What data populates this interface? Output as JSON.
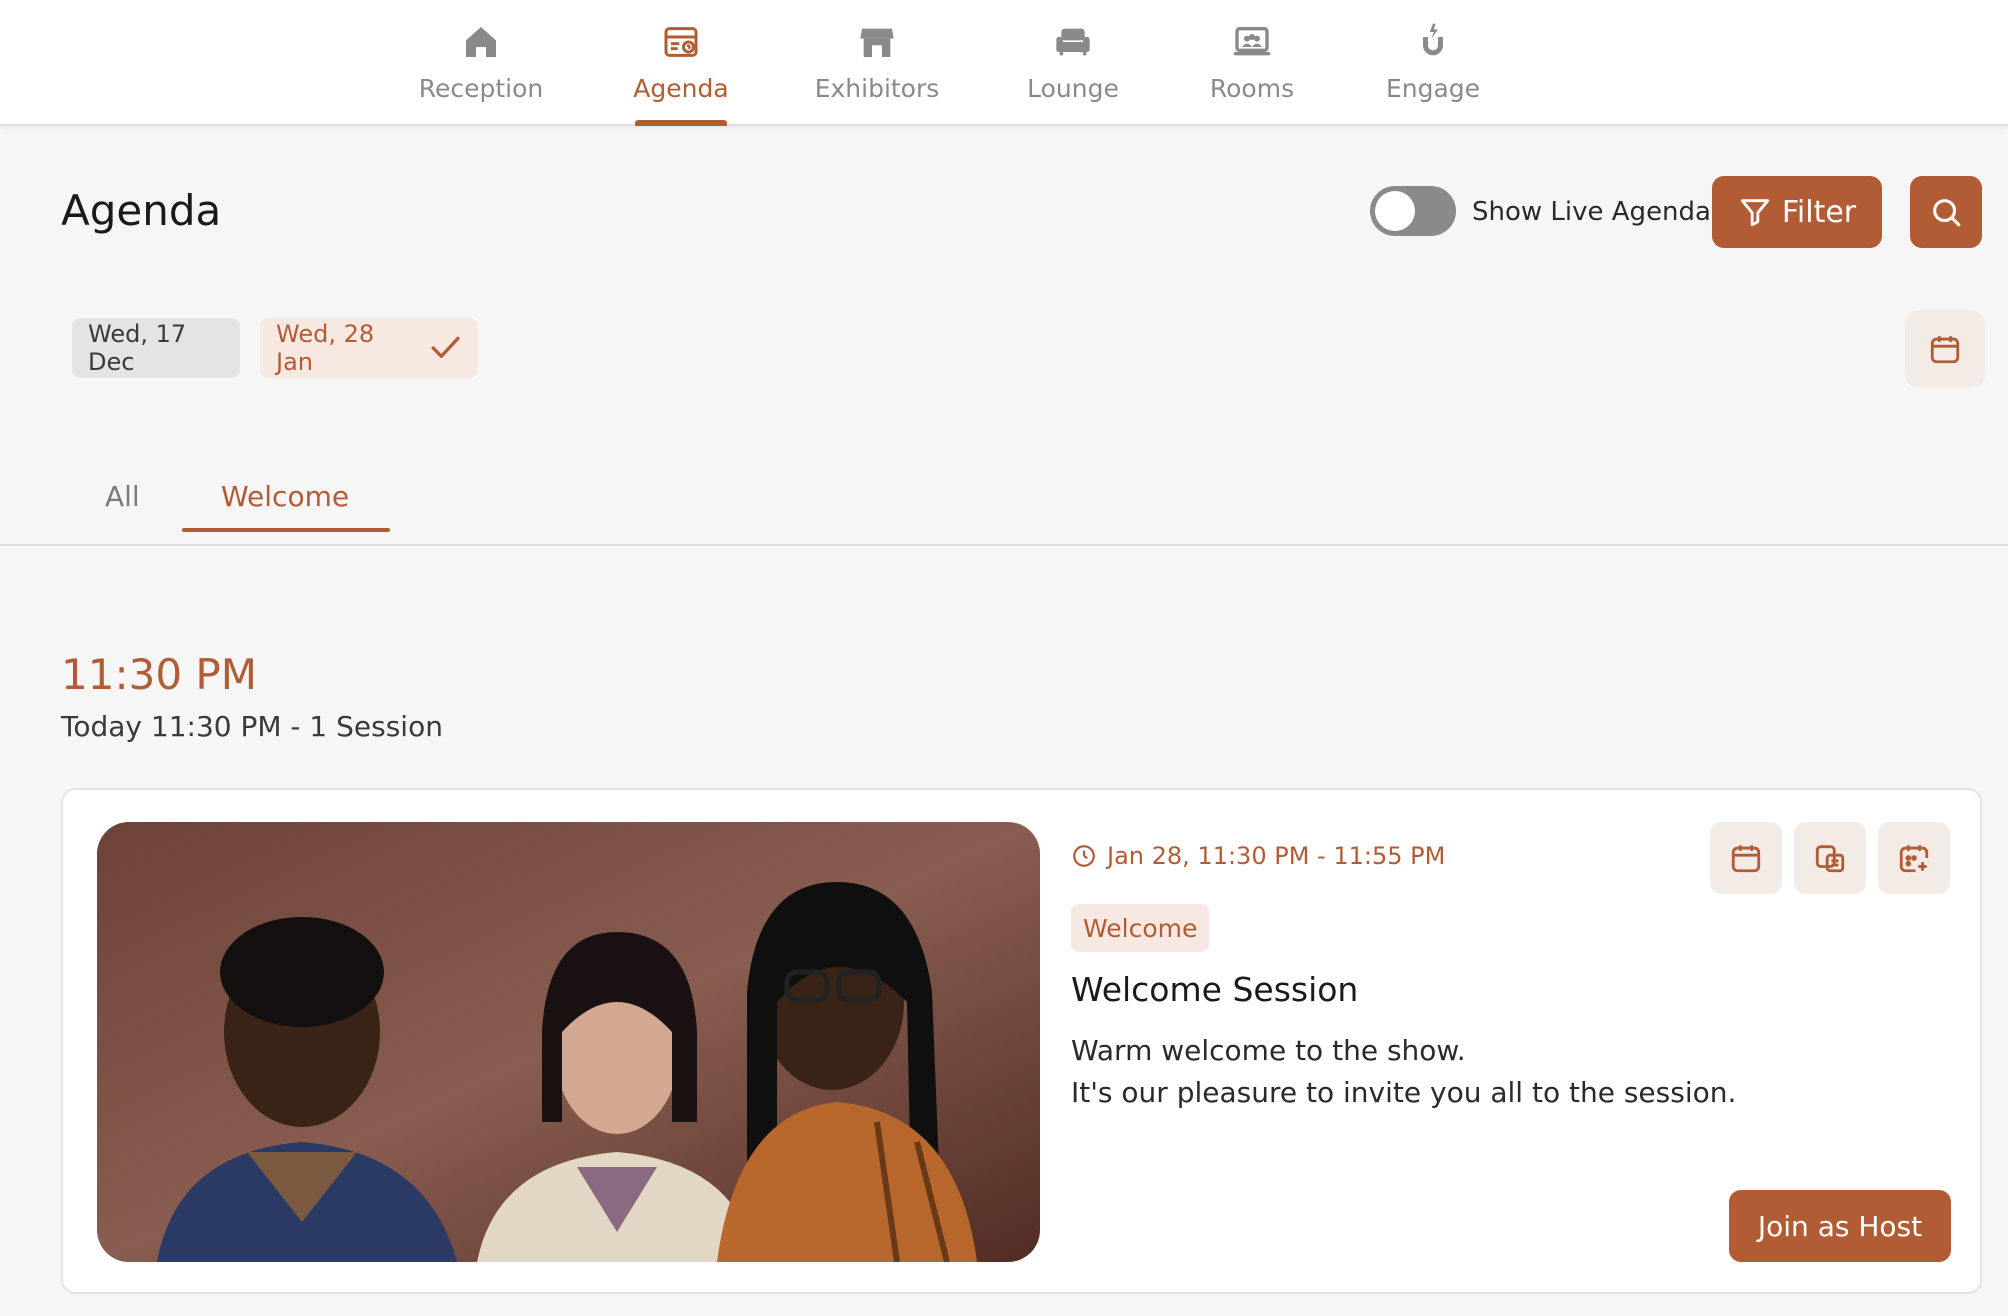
{
  "nav": {
    "items": [
      {
        "label": "Reception",
        "icon": "home-icon"
      },
      {
        "label": "Agenda",
        "icon": "agenda-icon",
        "active": true
      },
      {
        "label": "Exhibitors",
        "icon": "store-icon"
      },
      {
        "label": "Lounge",
        "icon": "sofa-icon"
      },
      {
        "label": "Rooms",
        "icon": "rooms-icon"
      },
      {
        "label": "Engage",
        "icon": "engage-icon"
      }
    ]
  },
  "header": {
    "title": "Agenda",
    "toggle_label": "Show Live Agenda",
    "toggle_on": false,
    "filter_label": "Filter"
  },
  "dates": [
    {
      "label": "Wed, 17 Dec",
      "selected": false
    },
    {
      "label": "Wed, 28 Jan",
      "selected": true
    }
  ],
  "tabs": [
    {
      "label": "All",
      "active": false
    },
    {
      "label": "Welcome",
      "active": true
    }
  ],
  "slot": {
    "time": "11:30 PM",
    "subtitle": "Today 11:30 PM - 1 Session"
  },
  "session": {
    "time_range": "Jan 28, 11:30 PM - 11:55 PM",
    "tag": "Welcome",
    "title": "Welcome Session",
    "description_line1": "Warm welcome to the show.",
    "description_line2": "It's our pleasure to invite you all to the session.",
    "join_label": "Join as Host"
  },
  "colors": {
    "accent": "#b25c35",
    "accent_light": "#f7e9e2",
    "muted": "#8a8a8a",
    "background": "#f6f6f6"
  }
}
